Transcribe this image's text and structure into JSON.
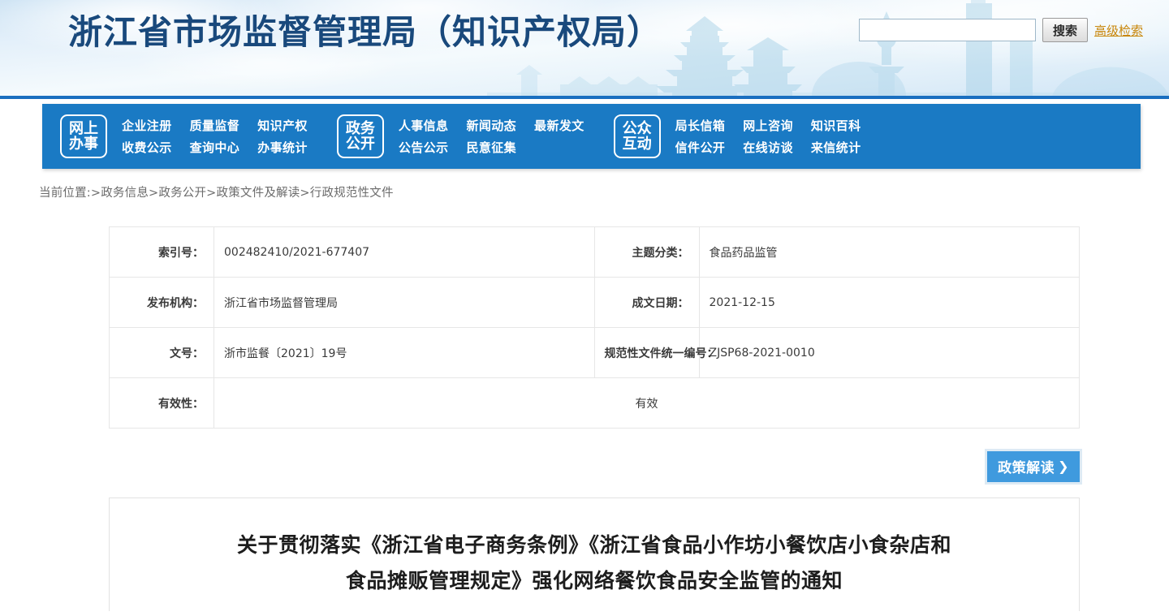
{
  "header": {
    "site_title": "浙江省市场监督管理局（知识产权局）",
    "search": {
      "value": "",
      "placeholder": "",
      "button_label": "搜索",
      "advanced_label": "高级检索"
    },
    "accent_color": "#1a7ac4",
    "title_color": "#19497c"
  },
  "nav": {
    "groups": [
      {
        "badge_line1": "网上",
        "badge_line2": "办事",
        "columns": [
          {
            "top": "企业注册",
            "bottom": "收费公示"
          },
          {
            "top": "质量监督",
            "bottom": "查询中心"
          },
          {
            "top": "知识产权",
            "bottom": "办事统计"
          }
        ]
      },
      {
        "badge_line1": "政务",
        "badge_line2": "公开",
        "columns": [
          {
            "top": "人事信息",
            "bottom": "公告公示"
          },
          {
            "top": "新闻动态",
            "bottom": "民意征集"
          },
          {
            "top": "最新发文",
            "bottom": ""
          }
        ]
      },
      {
        "badge_line1": "公众",
        "badge_line2": "互动",
        "columns": [
          {
            "top": "局长信箱",
            "bottom": "信件公开"
          },
          {
            "top": "网上咨询",
            "bottom": "在线访谈"
          },
          {
            "top": "知识百科",
            "bottom": "来信统计"
          }
        ]
      }
    ]
  },
  "breadcrumb": {
    "text": "当前位置:>政务信息>政务公开>政策文件及解读>行政规范性文件"
  },
  "meta": {
    "rows": [
      {
        "label_left": "索引号：",
        "value_left": "002482410/2021-677407",
        "label_right": "主题分类：",
        "value_right": "食品药品监管"
      },
      {
        "label_left": "发布机构：",
        "value_left": "浙江省市场监督管理局",
        "label_right": "成文日期：",
        "value_right": "2021-12-15"
      },
      {
        "label_left": "文号：",
        "value_left": "浙市监餐〔2021〕19号",
        "label_right": "规范性文件统一编号：",
        "value_right": "ZJSP68-2021-0010"
      }
    ],
    "validity_label": "有效性：",
    "validity_value": "有效"
  },
  "policy": {
    "button_label": "政策解读",
    "chevron": "❯",
    "color": "#3f9ade"
  },
  "article": {
    "title_line1": "关于贯彻落实《浙江省电子商务条例》《浙江省食品小作坊小餐饮店小食杂店和",
    "title_line2": "食品摊贩管理规定》强化网络餐饮食品安全监管的通知"
  }
}
